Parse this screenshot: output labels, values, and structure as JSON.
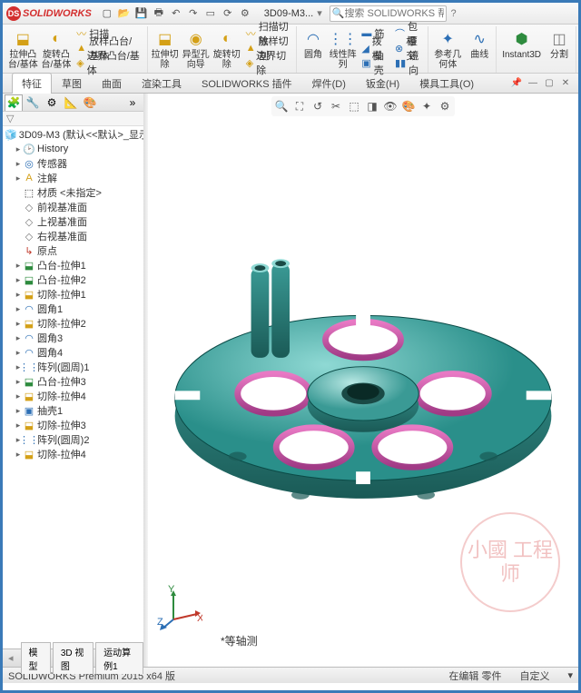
{
  "app": {
    "name": "SOLIDWORKS",
    "document": "3D09-M3...",
    "search_placeholder": "搜索 SOLIDWORKS 帮助"
  },
  "ribbon": {
    "extrude_boss": "拉伸凸\n台/基体",
    "revolve_boss": "旋转凸\n台/基体",
    "sweep": "扫描",
    "loft_boss": "放样凸台/基体",
    "boundary_boss": "边界凸台/基体",
    "extrude_cut": "拉伸切\n除",
    "hole": "异型孔\n向导",
    "revolve_cut": "旋转切\n除",
    "sweep_cut": "扫描切除",
    "loft_cut": "放样切割",
    "boundary_cut": "边界切除",
    "fillet": "圆角",
    "linear_pattern": "线性阵\n列",
    "rib": "筋",
    "draft": "拨模",
    "shell": "抽壳",
    "wrap": "包覆",
    "intersect": "相交",
    "mirror": "镜向",
    "ref_geom": "参考几\n何体",
    "curves": "曲线",
    "instant3d": "Instant3D",
    "split": "分割"
  },
  "tabs": {
    "features": "特征",
    "sketch": "草图",
    "surface": "曲面",
    "render": "渲染工具",
    "addins": "SOLIDWORKS 插件",
    "weld": "焊件(D)",
    "sheet": "钣金(H)",
    "mold": "模具工具(O)"
  },
  "tree": {
    "root": "3D09-M3 (默认<<默认>_显示",
    "history": "History",
    "sensors": "传感器",
    "annotations": "注解",
    "material": "材质 <未指定>",
    "front": "前视基准面",
    "top": "上视基准面",
    "right": "右视基准面",
    "origin": "原点",
    "items": [
      "凸台-拉伸1",
      "凸台-拉伸2",
      "切除-拉伸1",
      "圆角1",
      "切除-拉伸2",
      "圆角3",
      "圆角4",
      "阵列(圆周)1",
      "凸台-拉伸3",
      "切除-拉伸4",
      "抽壳1",
      "切除-拉伸3",
      "阵列(圆周)2",
      "切除-拉伸4"
    ]
  },
  "model_tabs": {
    "model": "模型",
    "view3d": "3D 视图",
    "motion": "运动算例1"
  },
  "view": {
    "label": "*等轴测"
  },
  "status": {
    "version": "SOLIDWORKS Premium 2015 x64 版",
    "editing": "在编辑 零件",
    "custom": "自定义"
  },
  "watermark": "小國\n工程师"
}
